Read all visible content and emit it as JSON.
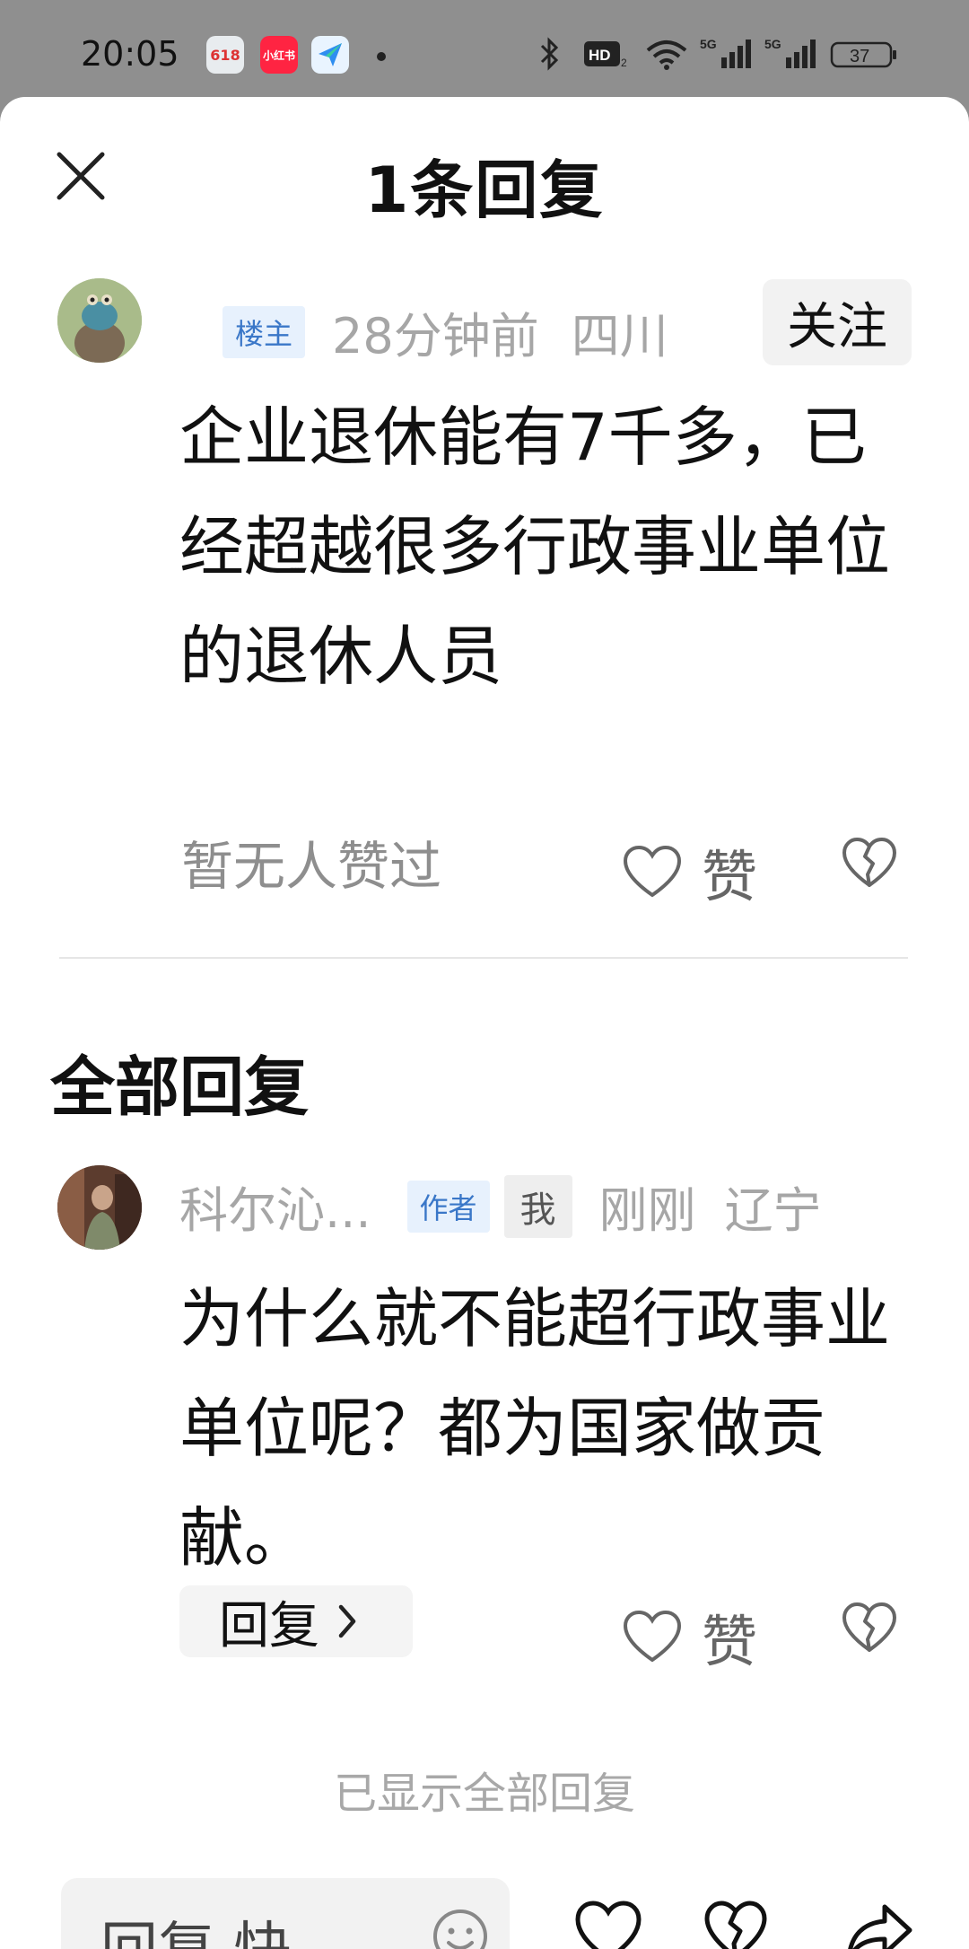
{
  "status_bar": {
    "time": "20:05",
    "apps": [
      "618",
      "小红书",
      "send-app"
    ],
    "network": "5G",
    "battery": "37"
  },
  "header": {
    "title": "1条回复"
  },
  "main_comment": {
    "badge": "楼主",
    "time": "28分钟前",
    "location": "四川",
    "follow_label": "关注",
    "text": "企业退休能有7千多，已经超越很多行政事业单位的退休人员",
    "likes_text": "暂无人赞过",
    "like_label": "赞"
  },
  "replies_section": {
    "title": "全部回复"
  },
  "reply": {
    "username": "科尔沁...",
    "author_badge": "作者",
    "me_badge": "我",
    "time": "刚刚",
    "location": "辽宁",
    "text": "为什么就不能超行政事业单位呢？都为国家做贡献。",
    "reply_button": "回复",
    "like_label": "赞"
  },
  "footer": {
    "all_shown": "已显示全部回复",
    "input_placeholder": "回复 快"
  },
  "colors": {
    "accent_blue": "#3a77c8",
    "tag_blue_bg": "#e7f1fd",
    "meta_gray": "#a6a6a6"
  }
}
